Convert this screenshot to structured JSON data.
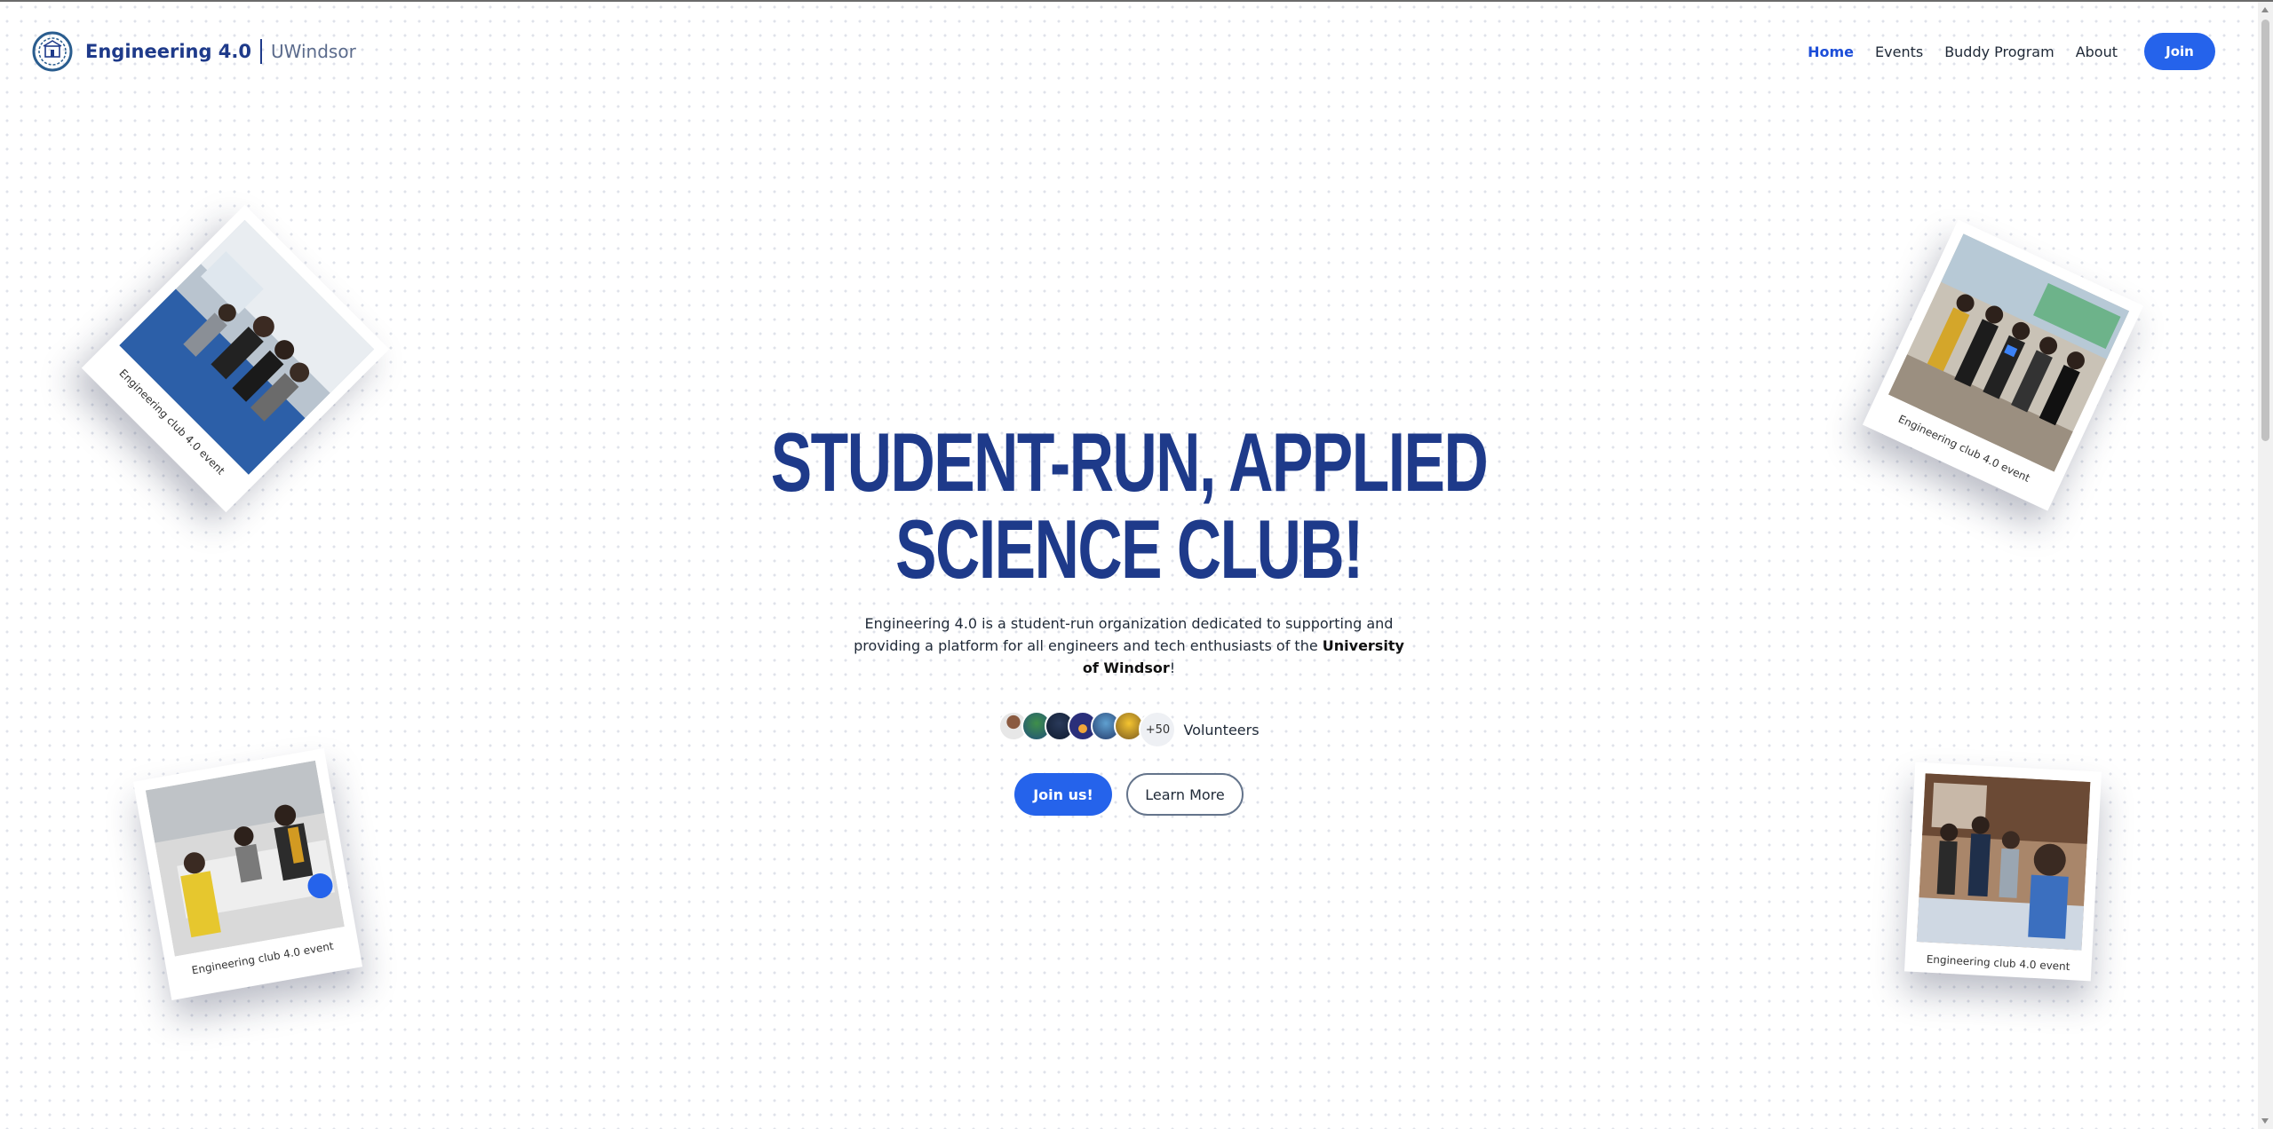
{
  "header": {
    "brand_name": "Engineering 4.0",
    "brand_sub": "UWindsor",
    "nav": [
      "Home",
      "Events",
      "Buddy Program",
      "About"
    ],
    "join_label": "Join"
  },
  "hero": {
    "title_line1": "STUDENT-RUN, APPLIED",
    "title_line2": "SCIENCE CLUB!",
    "desc_part1": "Engineering 4.0 is a student-run organization dedicated to supporting and providing a platform for all engineers and tech enthusiasts of the ",
    "desc_bold": "University of Windsor",
    "desc_end": "!",
    "volunteer_count": "+50",
    "volunteer_label": "Volunteers",
    "primary_cta": "Join us!",
    "secondary_cta": "Learn More"
  },
  "photos": [
    {
      "caption": "Engineering club 4.0 event"
    },
    {
      "caption": "Engineering club 4.0 event"
    },
    {
      "caption": "Engineering club 4.0 event"
    },
    {
      "caption": "Engineering club 4.0 event"
    }
  ],
  "colors": {
    "accent": "#2563eb",
    "title": "#1e3a8a"
  }
}
